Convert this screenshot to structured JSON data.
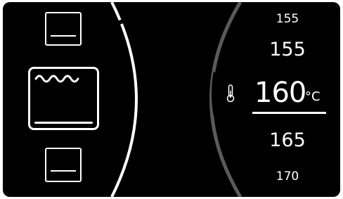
{
  "modes": [
    {
      "name": "oven-mode-previous",
      "selected": false
    },
    {
      "name": "oven-mode-top-heat-fan",
      "selected": true
    },
    {
      "name": "oven-mode-next",
      "selected": false
    }
  ],
  "temperature": {
    "options": [
      "155",
      "155",
      "165",
      "170"
    ],
    "far_top": "155",
    "near_top": "155",
    "selected": "160",
    "unit": "°C",
    "near_bottom": "165",
    "far_bottom": "170"
  },
  "icons": {
    "thermometer": "thermometer-icon",
    "heating_element": "wavy-heating-element-icon"
  },
  "colors": {
    "background": "#000000",
    "foreground": "#ffffff",
    "scale_track": "#5a5a5a"
  }
}
